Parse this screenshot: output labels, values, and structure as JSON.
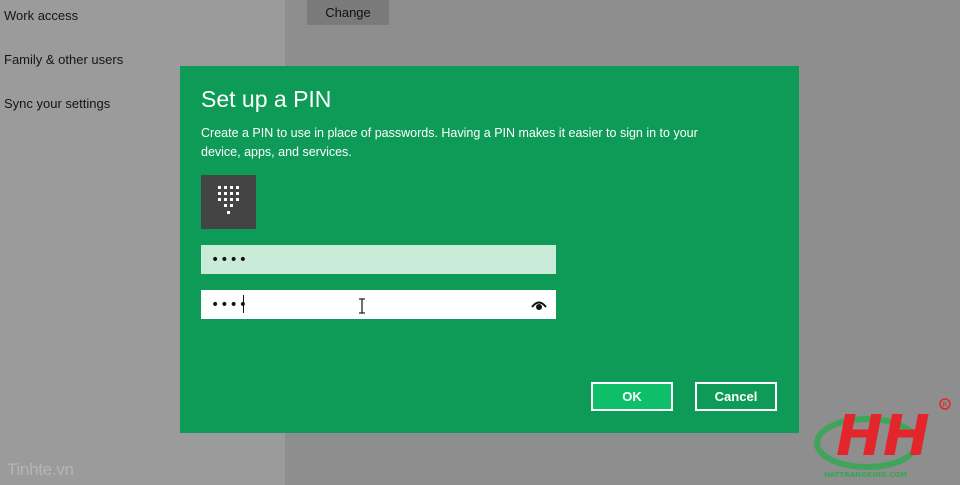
{
  "nav": {
    "items": [
      {
        "label": "Work access"
      },
      {
        "label": "Family & other users"
      },
      {
        "label": "Sync your settings"
      }
    ]
  },
  "content": {
    "change_label": "Change"
  },
  "dialog": {
    "title": "Set up a PIN",
    "description": "Create a PIN to use in place of passwords. Having a PIN makes it easier to sign in to your device, apps, and services.",
    "pin_value": "••••",
    "confirm_value": "••••",
    "ok_label": "OK",
    "cancel_label": "Cancel",
    "pin_icon": "keypad-icon",
    "reveal_icon": "eye-icon"
  },
  "watermark": {
    "left_text": "Tinhte.vn",
    "logo_letters": "HH",
    "logo_subtext": "HATTRANGKING.COM"
  },
  "colors": {
    "dialog_bg": "#0e9b57",
    "ok_bg": "#0dbf68",
    "pin_field_bg": "#c9ecd9",
    "logo_red": "#e3262b",
    "logo_green": "#32a852"
  }
}
